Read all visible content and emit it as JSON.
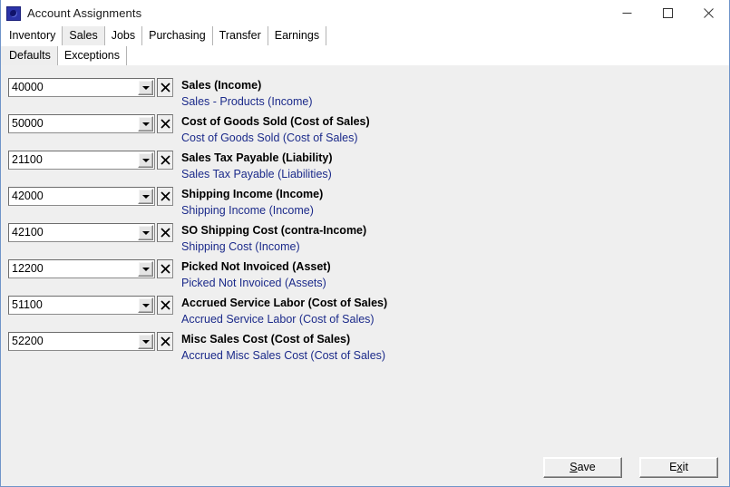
{
  "window": {
    "title": "Account Assignments",
    "icon": "app-icon",
    "caption": {
      "minimize_label": "Minimize",
      "maximize_label": "Maximize",
      "close_label": "Close"
    }
  },
  "tabs_main": [
    {
      "label": "Inventory",
      "selected": false
    },
    {
      "label": "Sales",
      "selected": true
    },
    {
      "label": "Jobs",
      "selected": false
    },
    {
      "label": "Purchasing",
      "selected": false
    },
    {
      "label": "Transfer",
      "selected": false
    },
    {
      "label": "Earnings",
      "selected": false
    }
  ],
  "tabs_sub": [
    {
      "label": "Defaults",
      "selected": true
    },
    {
      "label": "Exceptions",
      "selected": false
    }
  ],
  "assignments": [
    {
      "account": "40000",
      "title": "Sales (Income)",
      "link": "Sales - Products (Income)"
    },
    {
      "account": "50000",
      "title": "Cost of Goods Sold (Cost of Sales)",
      "link": "Cost of Goods Sold (Cost of Sales)"
    },
    {
      "account": "21100",
      "title": "Sales Tax Payable (Liability)",
      "link": "Sales Tax Payable (Liabilities)"
    },
    {
      "account": "42000",
      "title": "Shipping Income (Income)",
      "link": "Shipping Income (Income)"
    },
    {
      "account": "42100",
      "title": "SO Shipping Cost (contra-Income)",
      "link": "Shipping Cost (Income)"
    },
    {
      "account": "12200",
      "title": "Picked Not Invoiced (Asset)",
      "link": "Picked Not Invoiced (Assets)"
    },
    {
      "account": "51100",
      "title": "Accrued Service Labor (Cost of Sales)",
      "link": "Accrued Service Labor (Cost of Sales)"
    },
    {
      "account": "52200",
      "title": "Misc Sales Cost (Cost of Sales)",
      "link": "Accrued Misc Sales Cost (Cost of Sales)"
    }
  ],
  "buttons": {
    "save": {
      "before": "",
      "accel": "S",
      "after": "ave"
    },
    "exit": {
      "before": "E",
      "accel": "x",
      "after": "it"
    }
  },
  "colors": {
    "window_border": "#6f94c9",
    "panel_bg": "#efefef",
    "link": "#1b2a8a",
    "title_text": "#1a1a1a",
    "icon_blue": "#2b33a8"
  }
}
